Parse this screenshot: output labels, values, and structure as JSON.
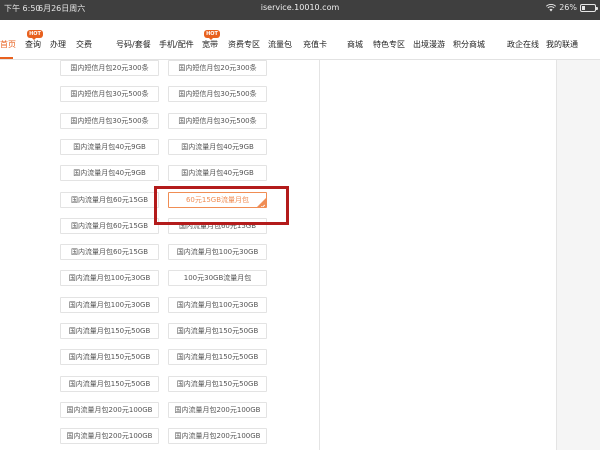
{
  "status_bar": {
    "time": "下午 6:50",
    "date": "6月26日周六",
    "url": "iservice.10010.com",
    "battery": "26%",
    "battery_level": 0.26,
    "wifi_icon": "wifi-icon",
    "battery_icon": "battery-icon"
  },
  "nav": {
    "items": [
      {
        "label": "首页"
      },
      {
        "label": "查询",
        "badge": "HOT"
      },
      {
        "label": "办理"
      },
      {
        "label": "交费"
      },
      {
        "label": "号码/套餐"
      },
      {
        "label": "手机/配件"
      },
      {
        "label": "宽带",
        "badge": "HOT"
      },
      {
        "label": "资费专区"
      },
      {
        "label": "流量包"
      },
      {
        "label": "充值卡"
      },
      {
        "label": "商城"
      },
      {
        "label": "特色专区"
      },
      {
        "label": "出境漫游"
      },
      {
        "label": "积分商城"
      },
      {
        "label": "政企在线"
      },
      {
        "label": "我的联通"
      }
    ],
    "active_index": 0,
    "accent_color": "#e8611f"
  },
  "packages": {
    "left": [
      "国内短信月包20元300条",
      "国内短信月包30元500条",
      "国内短信月包30元500条",
      "国内流量月包40元9GB",
      "国内流量月包40元9GB",
      "国内流量月包60元15GB",
      "国内流量月包60元15GB",
      "国内流量月包60元15GB",
      "国内流量月包100元30GB",
      "国内流量月包100元30GB",
      "国内流量月包150元50GB",
      "国内流量月包150元50GB",
      "国内流量月包150元50GB",
      "国内流量月包200元100GB",
      "国内流量月包200元100GB"
    ],
    "right": [
      "国内短信月包20元300条",
      "国内短信月包30元500条",
      "国内短信月包30元500条",
      "国内流量月包40元9GB",
      "国内流量月包40元9GB",
      "60元15GB流量月包",
      "国内流量月包60元15GB",
      "国内流量月包100元30GB",
      "100元30GB流量月包",
      "国内流量月包100元30GB",
      "国内流量月包150元50GB",
      "国内流量月包150元50GB",
      "国内流量月包150元50GB",
      "国内流量月包200元100GB",
      "国内流量月包200元100GB"
    ],
    "selected_side": "right",
    "selected_index": 5,
    "selected_color": "#f08d54",
    "highlight_color": "#b31b1b"
  }
}
